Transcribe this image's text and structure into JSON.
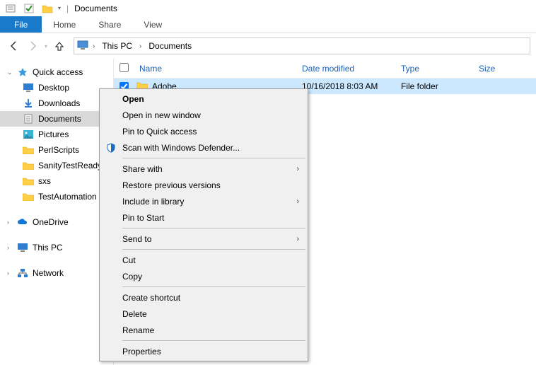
{
  "titlebar": {
    "title": "Documents"
  },
  "ribbon": {
    "file": "File",
    "home": "Home",
    "share": "Share",
    "view": "View"
  },
  "breadcrumb": {
    "root": "This PC",
    "current": "Documents"
  },
  "tree": {
    "quick_access": "Quick access",
    "items": [
      {
        "label": "Desktop"
      },
      {
        "label": "Downloads"
      },
      {
        "label": "Documents"
      },
      {
        "label": "Pictures"
      },
      {
        "label": "PerlScripts"
      },
      {
        "label": "SanityTestReady"
      },
      {
        "label": "sxs"
      },
      {
        "label": "TestAutomation"
      }
    ],
    "onedrive": "OneDrive",
    "thispc": "This PC",
    "network": "Network"
  },
  "columns": {
    "name": "Name",
    "date": "Date modified",
    "type": "Type",
    "size": "Size"
  },
  "rows": [
    {
      "name": "Adobe",
      "date": "10/16/2018 8:03 AM",
      "type": "File folder"
    }
  ],
  "ctx": {
    "open": "Open",
    "open_new": "Open in new window",
    "pin_qa": "Pin to Quick access",
    "defender": "Scan with Windows Defender...",
    "share_with": "Share with",
    "restore": "Restore previous versions",
    "include_lib": "Include in library",
    "pin_start": "Pin to Start",
    "send_to": "Send to",
    "cut": "Cut",
    "copy": "Copy",
    "shortcut": "Create shortcut",
    "delete": "Delete",
    "rename": "Rename",
    "properties": "Properties"
  }
}
